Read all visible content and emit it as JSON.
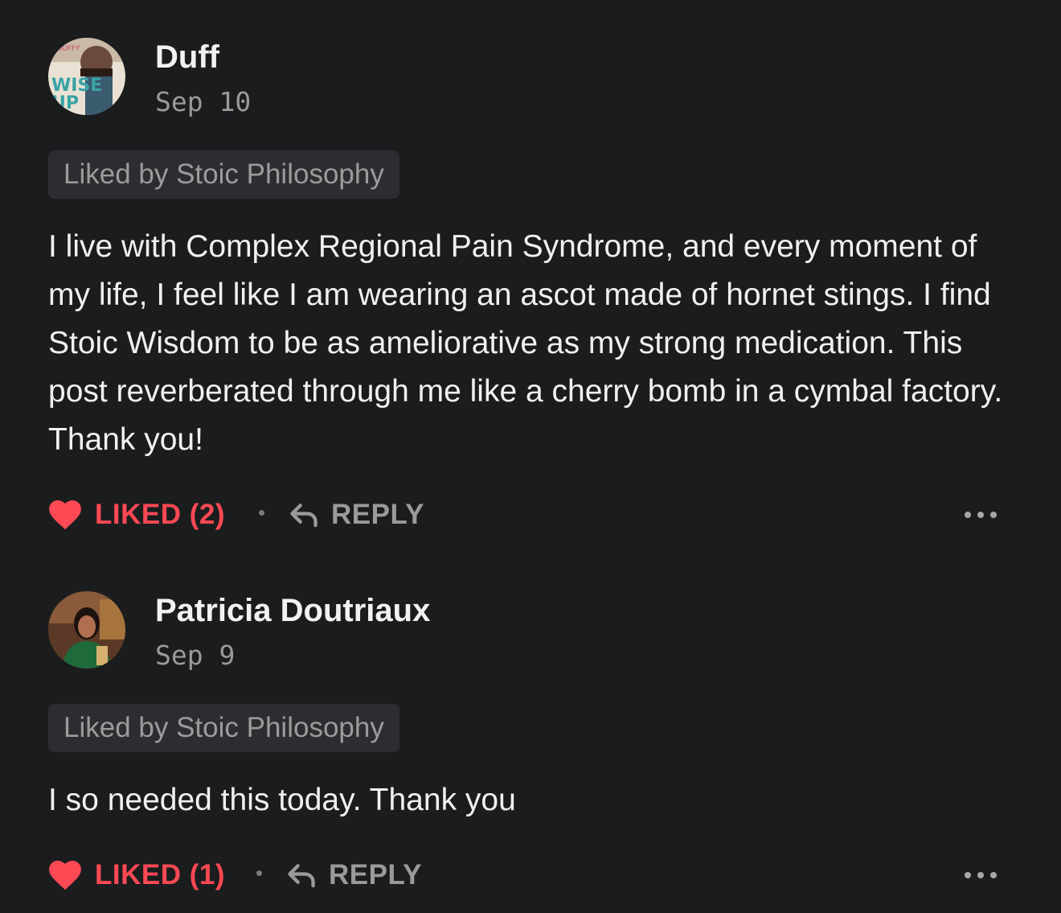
{
  "comments": [
    {
      "author": "Duff",
      "date": "Sep 10",
      "avatar_icon": "book-cover-avatar-icon",
      "avatar_text": "WISE UP",
      "liked_by": "Liked by Stoic Philosophy",
      "text": "I live with Complex Regional Pain Syndrome, and every moment of my life, I feel like I am wearing an ascot made of hornet stings. I find Stoic Wisdom to be as ameliorative as my strong medication. This post reverberated through me like a cherry bomb in a cymbal factory. Thank you!",
      "like_label": "LIKED (2)",
      "reply_label": "REPLY"
    },
    {
      "author": "Patricia Doutriaux",
      "date": "Sep 9",
      "avatar_icon": "person-photo-avatar-icon",
      "liked_by": "Liked by Stoic Philosophy",
      "text": "I so needed this today. Thank you",
      "like_label": "LIKED (1)",
      "reply_label": "REPLY"
    }
  ],
  "colors": {
    "background": "#1b1c1e",
    "liked": "#ff4954",
    "muted": "#9a9a9a",
    "badge_bg": "#2c2d30"
  },
  "icons": {
    "like": "heart-icon",
    "reply": "reply-arrow-icon",
    "more": "more-horizontal-icon"
  }
}
